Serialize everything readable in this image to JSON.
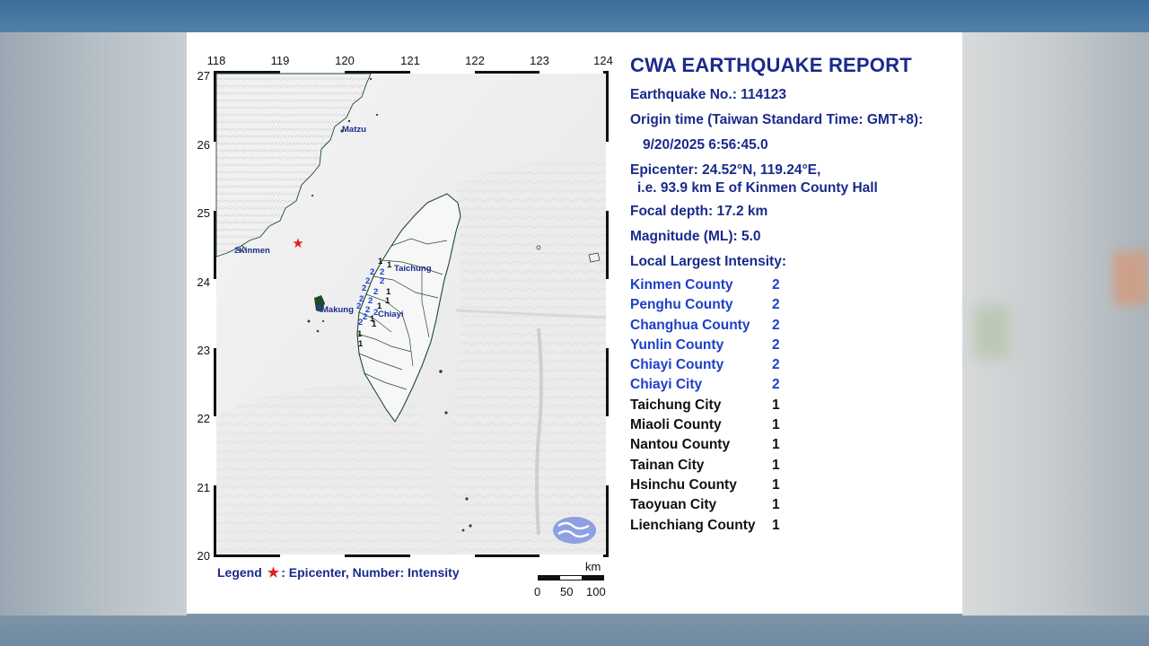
{
  "map": {
    "lon_ticks": [
      "118",
      "119",
      "120",
      "121",
      "122",
      "123",
      "124"
    ],
    "lat_ticks": [
      "27",
      "26",
      "25",
      "24",
      "23",
      "22",
      "21",
      "20"
    ],
    "place_labels": {
      "matzu": "Matzu",
      "kinmen": "Kinmen",
      "taichung": "Taichung",
      "makung": "Makung",
      "chiayi": "Chiayi"
    },
    "station_intensities": [
      "2",
      "2",
      "2",
      "2",
      "2",
      "2",
      "2",
      "2",
      "2",
      "2",
      "2",
      "2",
      "2",
      "2",
      "2",
      "1",
      "1",
      "1",
      "1",
      "1",
      "1",
      "1",
      "1",
      "1"
    ],
    "epicenter_marker_color": "#e32020",
    "land_color": "#f2f2f2",
    "border_color": "#1f4a2a",
    "intensity_color": "#1f3fc8",
    "icons": [
      "cwa-logo-icon",
      "epicenter-star-icon"
    ]
  },
  "legend": {
    "label": "Legend",
    "text": ": Epicenter, Number: Intensity"
  },
  "scale": {
    "unit": "km",
    "labels": [
      "0",
      "50",
      "100"
    ]
  },
  "report": {
    "title": "CWA EARTHQUAKE REPORT",
    "earthquake_no": "Earthquake No.: 114123",
    "origin_time_label": "Origin time (Taiwan Standard Time: GMT+8):",
    "origin_time": "9/20/2025  6:56:45.0",
    "epicenter": "Epicenter: 24.52°N, 119.24°E,",
    "epicenter_desc": "i.e. 93.9 km E of Kinmen County Hall",
    "focal_depth": "Focal depth: 17.2 km",
    "magnitude": "Magnitude (ML): 5.0",
    "local_intensity_label": "Local Largest Intensity:"
  },
  "intensities": [
    {
      "name": "Kinmen County",
      "value": "2"
    },
    {
      "name": "Penghu County",
      "value": "2"
    },
    {
      "name": "Changhua County",
      "value": "2"
    },
    {
      "name": "Yunlin County",
      "value": "2"
    },
    {
      "name": "Chiayi County",
      "value": "2"
    },
    {
      "name": "Chiayi City",
      "value": "2"
    },
    {
      "name": "Taichung City",
      "value": "1"
    },
    {
      "name": "Miaoli County",
      "value": "1"
    },
    {
      "name": "Nantou County",
      "value": "1"
    },
    {
      "name": "Tainan City",
      "value": "1"
    },
    {
      "name": "Hsinchu County",
      "value": "1"
    },
    {
      "name": "Taoyuan City",
      "value": "1"
    },
    {
      "name": "Lienchiang County",
      "value": "1"
    }
  ]
}
